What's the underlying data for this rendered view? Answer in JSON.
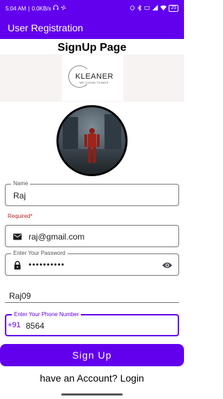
{
  "status_bar": {
    "time": "5:04 AM",
    "network": "0.0KB/s",
    "battery": "25"
  },
  "app_bar": {
    "title": "User Registration"
  },
  "page": {
    "title": "SignUp Page"
  },
  "logo": {
    "brand": "KLEANER",
    "tagline": "WE CLEAN THINGS"
  },
  "form": {
    "name": {
      "label": "Name",
      "value": "Raj"
    },
    "required_text": "Required*",
    "email": {
      "value": "raj@gmail.com"
    },
    "password": {
      "label": "Enter Your Password",
      "value": "••••••••••"
    },
    "username": {
      "value": "Raj09"
    },
    "phone": {
      "label": "Enter Your Phone Number",
      "prefix": "+91",
      "value": "8564"
    }
  },
  "signup_button": "Sign Up",
  "login_link": "have an Account? Login",
  "colors": {
    "primary": "#6200ee",
    "error": "#b3261e"
  }
}
